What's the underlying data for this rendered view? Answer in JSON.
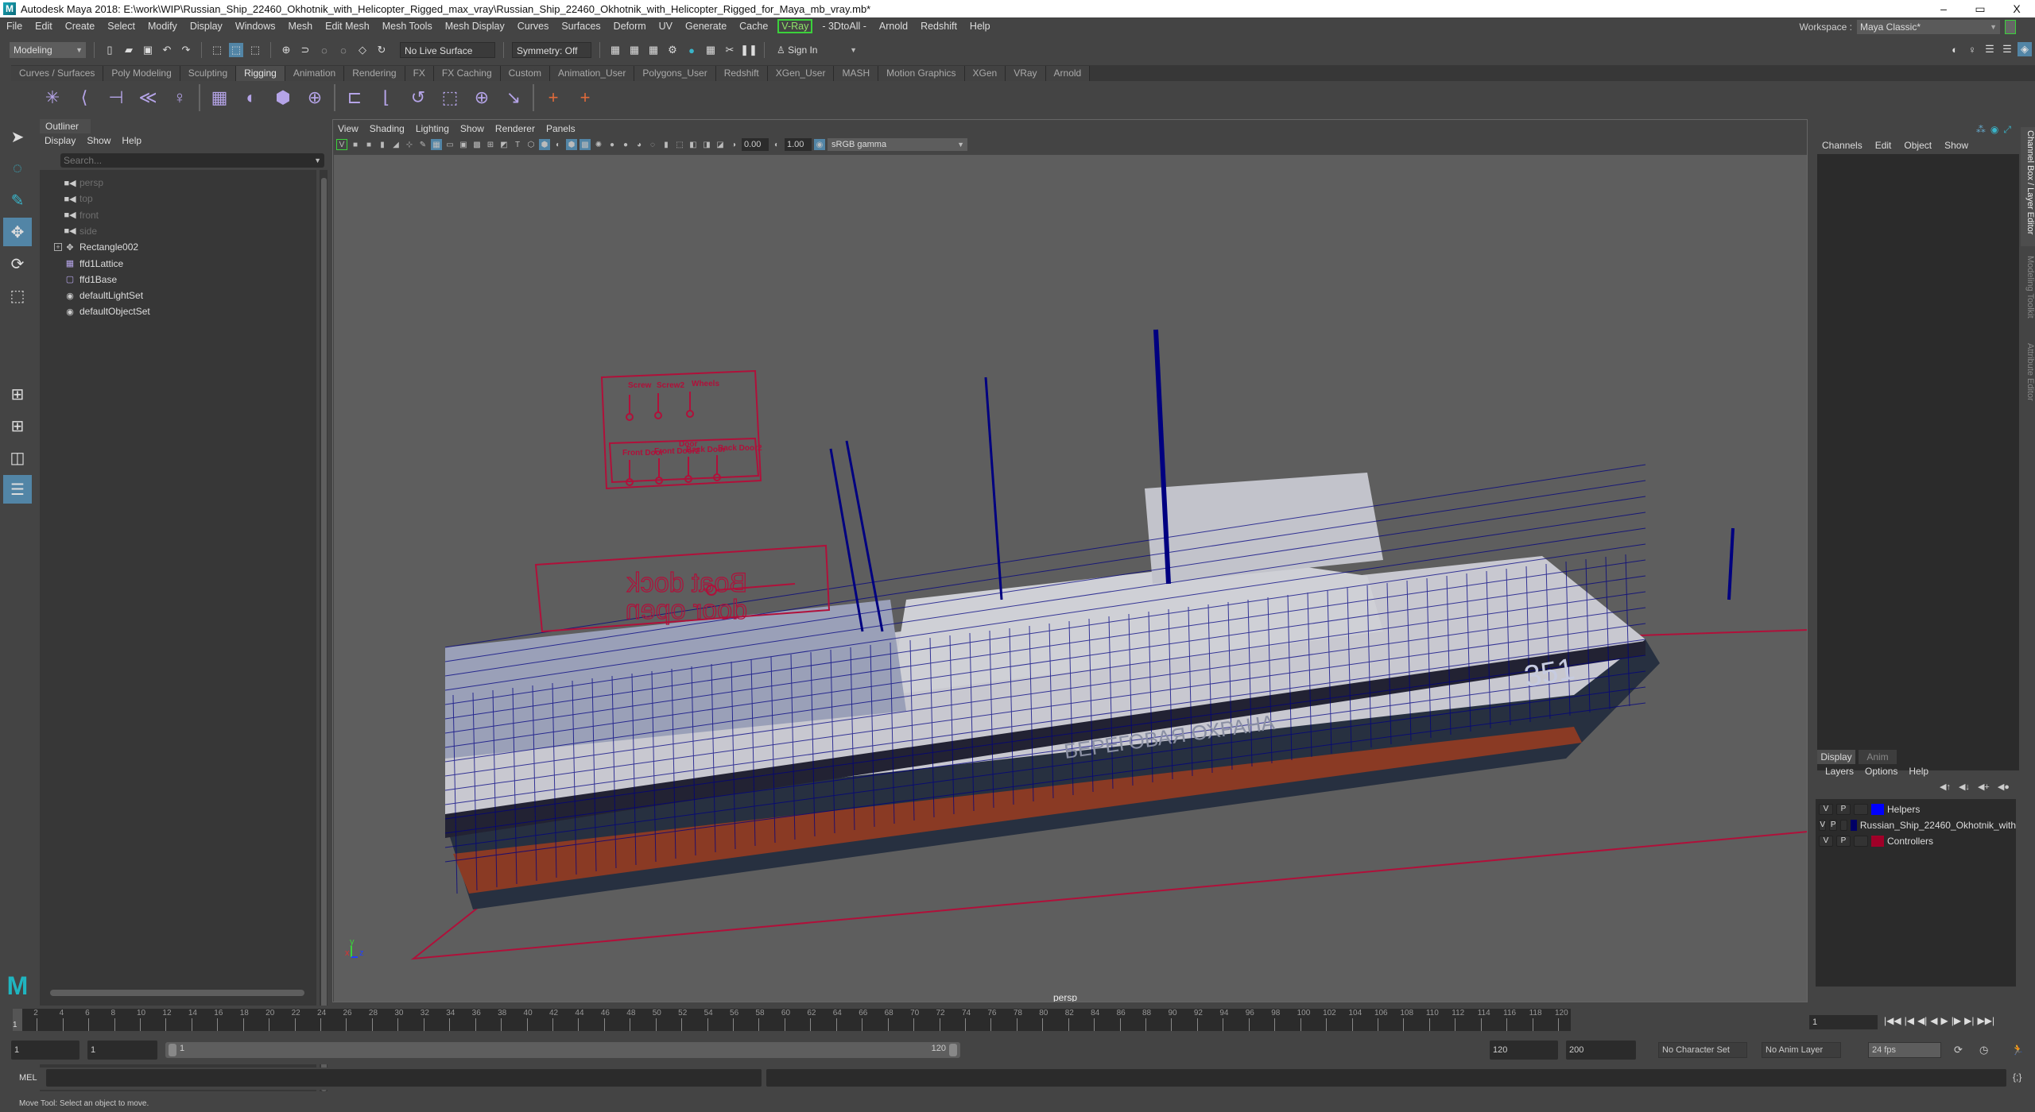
{
  "window": {
    "title": "Autodesk Maya 2018: E:\\work\\WIP\\Russian_Ship_22460_Okhotnik_with_Helicopter_Rigged_max_vray\\Russian_Ship_22460_Okhotnik_with_Helicopter_Rigged_for_Maya_mb_vray.mb*",
    "controls": {
      "minimize": "–",
      "maximize": "▭",
      "close": "X"
    }
  },
  "menubar": {
    "items": [
      "File",
      "Edit",
      "Create",
      "Select",
      "Modify",
      "Display",
      "Windows",
      "Mesh",
      "Edit Mesh",
      "Mesh Tools",
      "Mesh Display",
      "Curves",
      "Surfaces",
      "Deform",
      "UV",
      "Generate",
      "Cache",
      "V-Ray",
      "- 3DtoAll -",
      "Arnold",
      "Redshift",
      "Help"
    ],
    "workspace_label": "Workspace :",
    "workspace_value": "Maya Classic*"
  },
  "statusline": {
    "mode": "Modeling",
    "live_surface": "No Live Surface",
    "symmetry": "Symmetry: Off",
    "sign_in": "Sign In"
  },
  "shelf": {
    "tabs": [
      "Curves / Surfaces",
      "Poly Modeling",
      "Sculpting",
      "Rigging",
      "Animation",
      "Rendering",
      "FX",
      "FX Caching",
      "Custom",
      "Animation_User",
      "Polygons_User",
      "Redshift",
      "XGen_User",
      "MASH",
      "Motion Graphics",
      "XGen",
      "VRay",
      "Arnold"
    ],
    "active_tab": "Rigging",
    "icons": [
      "joint-tool",
      "ik-handle",
      "ik-spline",
      "bind-skin",
      "humanik",
      "lattice",
      "cluster",
      "wrap",
      "soft-mod",
      "parent-constraint",
      "point-constraint",
      "orient-constraint",
      "scale-constraint",
      "aim-constraint",
      "pole-vector",
      "locator",
      "locator-link"
    ]
  },
  "outliner": {
    "tab": "Outliner",
    "menu": [
      "Display",
      "Show",
      "Help"
    ],
    "search_placeholder": "Search...",
    "items": [
      {
        "label": "persp",
        "icon": "camera-icon",
        "dim": true
      },
      {
        "label": "top",
        "icon": "camera-icon",
        "dim": true
      },
      {
        "label": "front",
        "icon": "camera-icon",
        "dim": true
      },
      {
        "label": "side",
        "icon": "camera-icon",
        "dim": true
      },
      {
        "label": "Rectangle002",
        "icon": "transform-icon",
        "dim": false,
        "expandable": true
      },
      {
        "label": "ffd1Lattice",
        "icon": "lattice-icon",
        "dim": false
      },
      {
        "label": "ffd1Base",
        "icon": "lattice-base-icon",
        "dim": false
      },
      {
        "label": "defaultLightSet",
        "icon": "set-icon",
        "dim": false
      },
      {
        "label": "defaultObjectSet",
        "icon": "set-icon",
        "dim": false
      }
    ]
  },
  "viewport": {
    "menu": [
      "View",
      "Shading",
      "Lighting",
      "Show",
      "Renderer",
      "Panels"
    ],
    "exposure": "0.00",
    "gamma": "1.00",
    "color_space": "sRGB gamma",
    "camera": "persp",
    "axis": {
      "x": "x",
      "y": "y",
      "z": "z"
    },
    "scene_labels": {
      "controls_top": [
        "Screw",
        "Screw2",
        "Wheels"
      ],
      "door_group": "Door",
      "door_controls": [
        "Front Door",
        "Front Door2",
        "Back Door",
        "Back Door2"
      ],
      "dock_line1": "Boat dock",
      "dock_line2": "door open",
      "hull_number": "351",
      "hull_text": "БЕРЕГОВАЯ ОХРАНА"
    }
  },
  "channelbox": {
    "menu": [
      "Channels",
      "Edit",
      "Object",
      "Show"
    ],
    "side_tabs": [
      "Channel Box / Layer Editor",
      "Modeling Toolkit",
      "Attribute Editor"
    ]
  },
  "layers": {
    "tabs": [
      "Display",
      "Anim"
    ],
    "menu": [
      "Layers",
      "Options",
      "Help"
    ],
    "rows": [
      {
        "v": "V",
        "p": "P",
        "name": "Helpers",
        "color": "#0000ff"
      },
      {
        "v": "V",
        "p": "P",
        "name": "Russian_Ship_22460_Okhotnik_with",
        "color": "#000066"
      },
      {
        "v": "V",
        "p": "P",
        "name": "Controllers",
        "color": "#a00028"
      }
    ]
  },
  "timeline": {
    "start": 1,
    "end": 120,
    "current_frame": "1",
    "labels": [
      "2",
      "4",
      "6",
      "8",
      "10",
      "12",
      "14",
      "16",
      "18",
      "20",
      "22",
      "24",
      "26",
      "28",
      "30",
      "32",
      "34",
      "36",
      "38",
      "40",
      "42",
      "44",
      "46",
      "48",
      "50",
      "52",
      "54",
      "56",
      "58",
      "60",
      "62",
      "64",
      "66",
      "68",
      "70",
      "72",
      "74",
      "76",
      "78",
      "80",
      "82",
      "84",
      "86",
      "88",
      "90",
      "92",
      "94",
      "96",
      "98",
      "100",
      "102",
      "104",
      "106",
      "108",
      "110",
      "112",
      "114",
      "116",
      "118",
      "120"
    ],
    "current_field": "1"
  },
  "range": {
    "start_field": "1",
    "playback_start": "1",
    "slider_start": "1",
    "slider_end": "120",
    "playback_end": "120",
    "end_field": "200",
    "character_set": "No Character Set",
    "anim_layer": "No Anim Layer",
    "fps": "24 fps"
  },
  "cmdline": {
    "label": "MEL"
  },
  "helpline": {
    "text": "Move Tool: Select an object to move."
  },
  "colors": {
    "accent": "#5285a6",
    "wire": "#000080",
    "controller": "#b0103a",
    "vray": "#3bd13b"
  }
}
